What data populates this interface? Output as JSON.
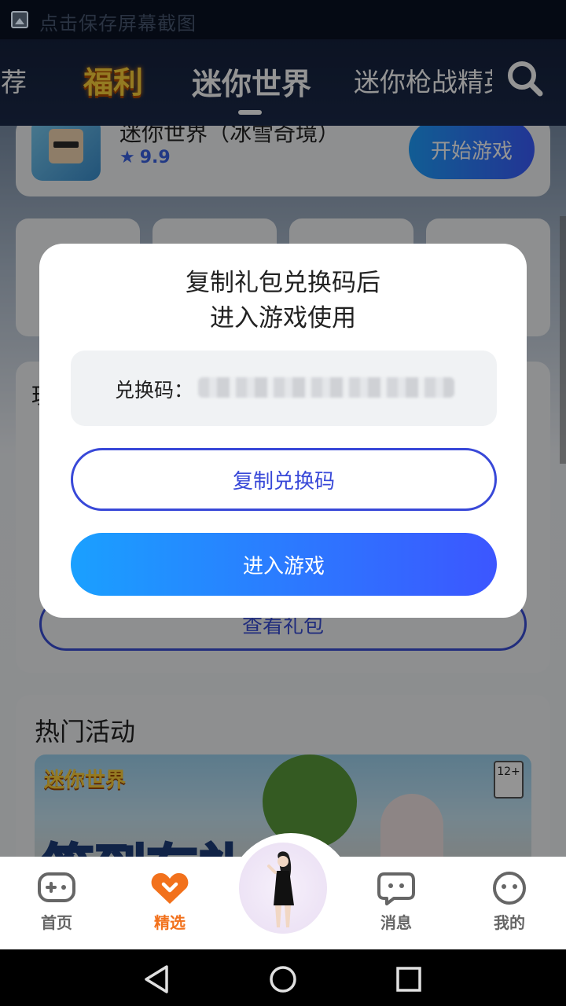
{
  "status_bar": {
    "notification_text": "点击保存屏幕截图"
  },
  "top_nav": {
    "tabs": [
      {
        "label": "推荐",
        "partial_display": "推荐"
      },
      {
        "label": "福利"
      },
      {
        "label": "迷你世界",
        "active": true
      },
      {
        "label": "迷你枪战精英",
        "partial_display": "迷你枪战精英"
      }
    ],
    "search_icon": "search-icon"
  },
  "game_card": {
    "name": "迷你世界（冰雪奇境）",
    "rating": "9.9",
    "start_label": "开始游戏"
  },
  "gift_section": {
    "title_partial": "玩",
    "view_gift_label": "查看礼包"
  },
  "events_section": {
    "title": "热门活动",
    "banner": {
      "logo_text": "迷你世界",
      "age_rating": "12+",
      "headline": "签到有礼"
    }
  },
  "modal": {
    "title_line1": "复制礼包兑换码后",
    "title_line2": "进入游戏使用",
    "code_label": "兑换码：",
    "code_value": "(blurred)",
    "copy_button": "复制兑换码",
    "enter_button": "进入游戏"
  },
  "bottom_tabs": [
    {
      "label": "首页",
      "icon": "gamepad-icon"
    },
    {
      "label": "精选",
      "icon": "heart-chevron-icon",
      "active": true
    },
    {
      "label": "消息",
      "icon": "chat-bubble-icon"
    },
    {
      "label": "我的",
      "icon": "smiley-icon"
    }
  ],
  "colors": {
    "accent_blue": "#3a4fd8",
    "gradient_start": "#1aa0ff",
    "gradient_end": "#3c56ff",
    "active_tab_orange": "#f2711c"
  }
}
